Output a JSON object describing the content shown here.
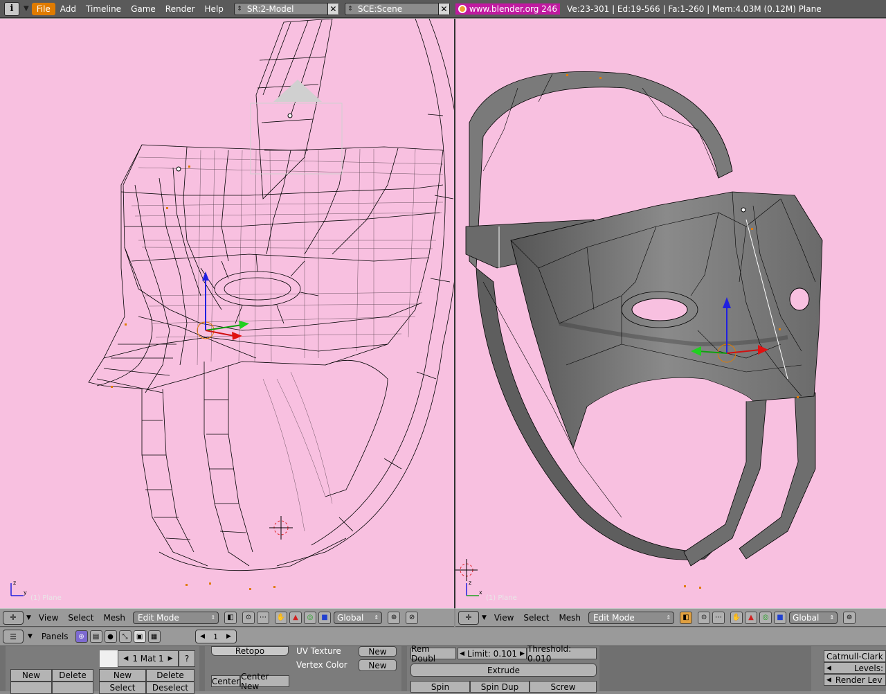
{
  "topbar": {
    "menus": [
      "File",
      "Add",
      "Timeline",
      "Game",
      "Render",
      "Help"
    ],
    "screen": "SR:2-Model",
    "scene": "SCE:Scene",
    "version": "www.blender.org 246",
    "stats": "Ve:23-301 | Ed:19-566 | Fa:1-260 | Mem:4.03M (0.12M) Plane"
  },
  "viewports": {
    "left_label": "(1) Plane",
    "right_label": "(1) Plane",
    "background": "#f8c0e0"
  },
  "viewport_header": {
    "menus": [
      "View",
      "Select",
      "Mesh"
    ],
    "mode": "Edit Mode",
    "orientation": "Global"
  },
  "buttons_header": {
    "panels_label": "Panels",
    "frame": "1"
  },
  "panels": {
    "material_name": "1 Mat 1",
    "material_help": "?",
    "new": "New",
    "delete": "Delete",
    "new2": "New",
    "delete2": "Delete",
    "select": "Select",
    "deselect": "Deselect",
    "retopo": "Retopo",
    "uv_texture": "UV Texture",
    "vertex_color": "Vertex Color",
    "uv_new": "New",
    "vc_new": "New",
    "center": "Center",
    "center_new": "Center New",
    "rem_doubles": "Rem Doubl",
    "limit": "Limit: 0.101",
    "threshold": "Threshold: 0.010",
    "extrude": "Extrude",
    "spin": "Spin",
    "spin_dup": "Spin Dup",
    "screw": "Screw",
    "subsurf_type": "Catmull-Clark",
    "levels": "Levels:",
    "render_levels": "Render Lev"
  }
}
